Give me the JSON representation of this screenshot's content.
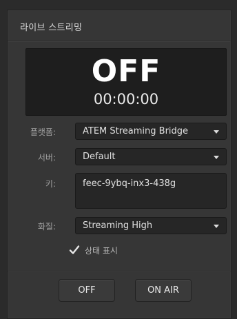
{
  "panel": {
    "title": "라이브 스트리밍"
  },
  "display": {
    "status": "OFF",
    "timecode": "00:00:00"
  },
  "form": {
    "platform": {
      "label": "플랫폼:",
      "value": "ATEM Streaming Bridge"
    },
    "server": {
      "label": "서버:",
      "value": "Default"
    },
    "key": {
      "label": "키:",
      "value": "feec-9ybq-inx3-438g"
    },
    "quality": {
      "label": "화질:",
      "value": "Streaming High"
    }
  },
  "status_checkbox": {
    "label": "상태 표시",
    "checked": true
  },
  "buttons": {
    "off_label": "OFF",
    "on_air_label": "ON AIR"
  },
  "icons": {
    "dropdown": "chevron-down-icon",
    "checkbox": "checkmark-icon"
  },
  "colors": {
    "background": "#2b2b2b",
    "panel": "#363636",
    "display": "#1e1e1e",
    "field": "#262626",
    "text": "#e0e0e0"
  }
}
